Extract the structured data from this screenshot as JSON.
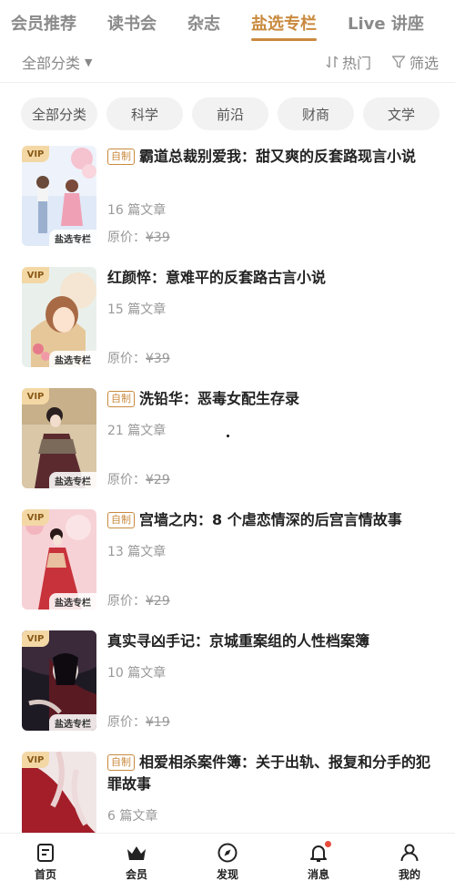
{
  "top_tabs": [
    "会员推荐",
    "读书会",
    "杂志",
    "盐选专栏",
    "Live 讲座"
  ],
  "filter": {
    "category": "全部分类",
    "sort": "热门",
    "filter": "筛选"
  },
  "chips": [
    "全部分类",
    "科学",
    "前沿",
    "财商",
    "文学"
  ],
  "vip_label": "VIP",
  "ribbon_label": "盐选专栏",
  "badge_label": "自制",
  "price_prefix": "原价：",
  "books": [
    {
      "badge": "自制",
      "title": "霸道总裁别爱我：甜又爽的反套路现言小说",
      "count": "16 篇文章",
      "price": "¥39"
    },
    {
      "badge": "",
      "title": "红颜悴：意难平的反套路古言小说",
      "count": "15 篇文章",
      "price": "¥39"
    },
    {
      "badge": "自制",
      "title": "洗铅华：恶毒女配生存录",
      "count": "21 篇文章",
      "price": "¥29"
    },
    {
      "badge": "自制",
      "title": "宫墙之内：8 个虐恋情深的后宫言情故事",
      "count": "13 篇文章",
      "price": "¥29"
    },
    {
      "badge": "",
      "title": "真实寻凶手记：京城重案组的人性档案簿",
      "count": "10 篇文章",
      "price": "¥19"
    },
    {
      "badge": "自制",
      "title": "相爱相杀案件簿：关于出轨、报复和分手的犯罪故事",
      "count": "6 篇文章",
      "price": ""
    }
  ],
  "nav": [
    {
      "label": "首页",
      "icon": "home-icon"
    },
    {
      "label": "会员",
      "icon": "crown-icon"
    },
    {
      "label": "发现",
      "icon": "compass-icon"
    },
    {
      "label": "消息",
      "icon": "bell-icon"
    },
    {
      "label": "我的",
      "icon": "person-icon"
    }
  ],
  "colors": {
    "accent": "#c98a3e",
    "vip_bg": "#f3d8a6",
    "notify": "#e84b3c"
  }
}
